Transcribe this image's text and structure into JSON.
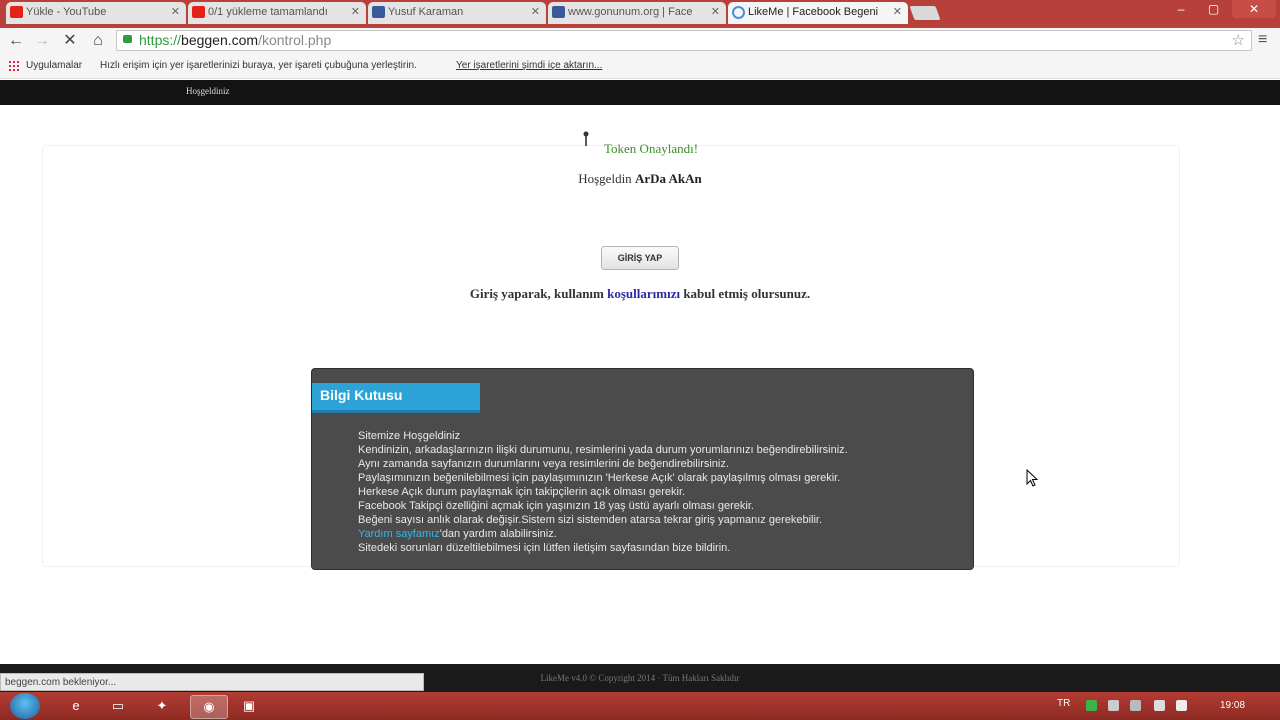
{
  "browser": {
    "tabs": [
      {
        "label": "Yükle - YouTube",
        "icon": "youtube-icon"
      },
      {
        "label": "0/1 yükleme tamamlandı",
        "icon": "youtube-icon"
      },
      {
        "label": "Yusuf Karaman",
        "icon": "facebook-icon"
      },
      {
        "label": "www.gonunum.org | Face",
        "icon": "facebook-icon"
      },
      {
        "label": "LikeMe | Facebook Begeni",
        "icon": "loading-icon"
      }
    ],
    "window_buttons": {
      "minimize": "–",
      "maximize": "▢",
      "close": "✕"
    },
    "url": {
      "scheme": "https://",
      "host": "beggen.com",
      "path": "/kontrol.php"
    },
    "bookmarks": {
      "apps_label": "Uygulamalar",
      "hint": "Hızlı erişim için yer işaretlerinizi buraya, yer işareti çubuğuna yerleştirin.",
      "import_link": "Yer işaretlerini şimdi içe aktarın..."
    },
    "status": "beggen.com bekleniyor..."
  },
  "site": {
    "nav_link": "Hoşgeldiniz",
    "token_status": "Token Onaylandı!",
    "welcome_prefix": "Hoşgeldin",
    "user_name": "ArDa AkAn",
    "login_button": "GİRİŞ YAP",
    "terms_prefix": "Giriş yaparak, kullanım",
    "terms_link": "koşullarımızı",
    "terms_suffix": "kabul etmiş olursunuz.",
    "infobox": {
      "title": "Bilgi Kutusu",
      "lines": [
        "Sitemize Hoşgeldiniz",
        "Kendinizin, arkadaşlarınızın ilişki durumunu, resimlerini yada durum yorumlarınızı beğendirebilirsiniz.",
        "Aynı zamanda sayfanızın durumlarını veya resimlerini de beğendirebilirsiniz.",
        "Paylaşımınızın beğenilebilmesi için paylaşımınızın 'Herkese Açık' olarak paylaşılmış olması gerekir.",
        "Herkese Açık durum paylaşmak için takipçilerin açık olması gerekir.",
        "Facebook Takipçi özelliğini açmak için yaşınızın 18 yaş üstü ayarlı olması gerekir.",
        "Beğeni sayısı anlık olarak değişir.Sistem sizi sistemden atarsa tekrar giriş yapmanız gerekebilir."
      ],
      "help_link": "Yardım sayfamız",
      "help_suffix": "'dan yardım alabilirsiniz.",
      "last_line": "Sitedeki sorunları düzeltilebilmesi için lütfen iletişim sayfasından bize bildirin."
    },
    "footer": "LikeMe v4.0 © Copyright 2014 · Tüm Hakları Saklıdır"
  },
  "taskbar": {
    "language": "TR",
    "clock": "19:08"
  },
  "colors": {
    "tabstrip": "#b8403a",
    "infobox_bg": "#4b4b4b",
    "infobox_title": "#2da3d8",
    "token_green": "#3a8f2a",
    "terms_link": "#2a2aa8"
  }
}
